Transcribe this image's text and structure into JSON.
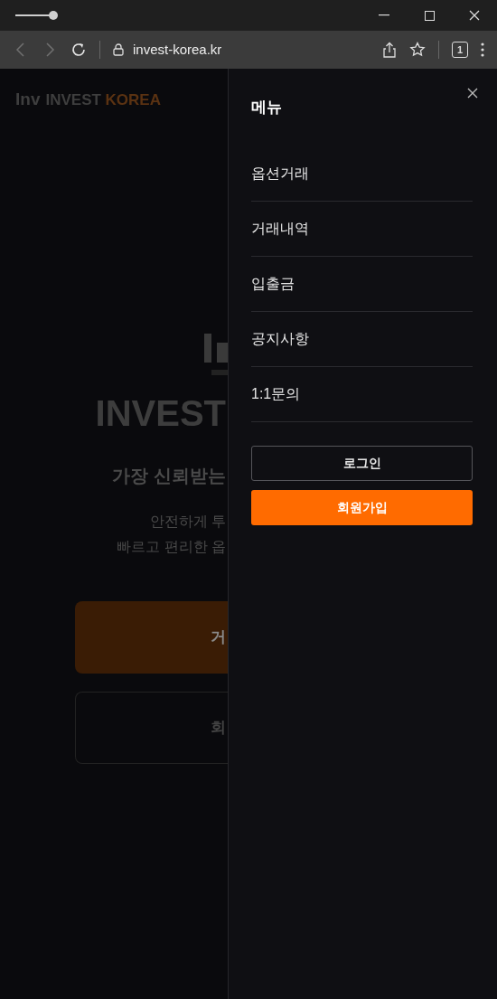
{
  "browser": {
    "url": "invest-korea.kr",
    "tab_count": "1",
    "back": {
      "disabled": true
    },
    "forward": {
      "disabled": true
    }
  },
  "page": {
    "logo_mark": "Inv",
    "brand": [
      {
        "text": "INVEST ",
        "accent": false
      },
      {
        "text": "KOREA",
        "accent": true
      }
    ],
    "hero_title": "INVEST",
    "tagline": "가장 신뢰받는",
    "description": [
      "안전하게 투",
      "빠르고 편리한 옵"
    ],
    "buttons": [
      {
        "label": "거",
        "kind": "primary"
      },
      {
        "label": "회",
        "kind": "outline"
      }
    ]
  },
  "menu": {
    "title": "메뉴",
    "items": [
      "옵션거래",
      "거래내역",
      "입출금",
      "공지사항",
      "1:1문의"
    ],
    "buttons": [
      {
        "label": "로그인",
        "kind": "outline"
      },
      {
        "label": "회원가입",
        "kind": "primary"
      }
    ]
  }
}
